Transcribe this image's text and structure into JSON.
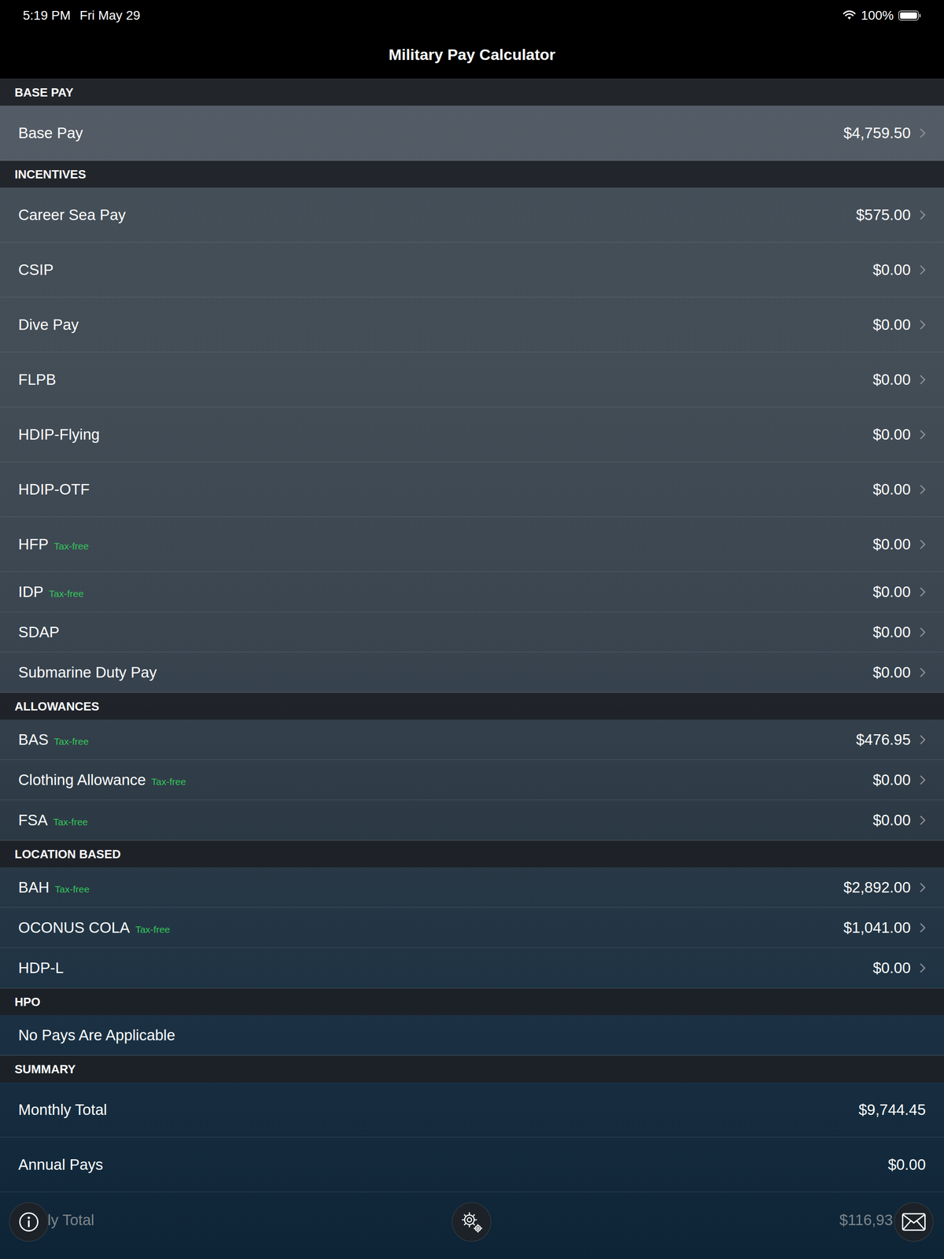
{
  "status_bar": {
    "time": "5:19 PM",
    "date": "Fri May 29",
    "battery": "100%"
  },
  "window": {
    "title": "Military Pay Calculator"
  },
  "sections": [
    {
      "header": "BASE PAY",
      "rows": [
        {
          "label": "Base Pay",
          "badge": "",
          "value": "$4,759.50",
          "kind": "nav"
        }
      ]
    },
    {
      "header": "INCENTIVES",
      "rows": [
        {
          "label": "Career Sea Pay",
          "badge": "",
          "value": "$575.00",
          "kind": "nav"
        },
        {
          "label": "CSIP",
          "badge": "",
          "value": "$0.00",
          "kind": "nav"
        },
        {
          "label": "Dive Pay",
          "badge": "",
          "value": "$0.00",
          "kind": "nav"
        },
        {
          "label": "FLPB",
          "badge": "",
          "value": "$0.00",
          "kind": "nav"
        },
        {
          "label": "HDIP-Flying",
          "badge": "",
          "value": "$0.00",
          "kind": "nav"
        },
        {
          "label": "HDIP-OTF",
          "badge": "",
          "value": "$0.00",
          "kind": "nav"
        },
        {
          "label": "HFP",
          "badge": "Tax-free",
          "value": "$0.00",
          "kind": "nav"
        },
        {
          "label": "IDP",
          "badge": "Tax-free",
          "value": "$0.00",
          "kind": "nav"
        },
        {
          "label": "SDAP",
          "badge": "",
          "value": "$0.00",
          "kind": "nav"
        },
        {
          "label": "Submarine Duty Pay",
          "badge": "",
          "value": "$0.00",
          "kind": "nav"
        }
      ]
    },
    {
      "header": "ALLOWANCES",
      "rows": [
        {
          "label": "BAS",
          "badge": "Tax-free",
          "value": "$476.95",
          "kind": "nav"
        },
        {
          "label": "Clothing Allowance",
          "badge": "Tax-free",
          "value": "$0.00",
          "kind": "nav"
        },
        {
          "label": "FSA",
          "badge": "Tax-free",
          "value": "$0.00",
          "kind": "nav"
        }
      ]
    },
    {
      "header": "LOCATION BASED",
      "rows": [
        {
          "label": "BAH",
          "badge": "Tax-free",
          "value": "$2,892.00",
          "kind": "nav"
        },
        {
          "label": "OCONUS COLA",
          "badge": "Tax-free",
          "value": "$1,041.00",
          "kind": "nav"
        },
        {
          "label": "HDP-L",
          "badge": "",
          "value": "$0.00",
          "kind": "nav"
        }
      ]
    },
    {
      "header": "HPO",
      "rows": [
        {
          "label": "No Pays Are Applicable",
          "badge": "",
          "value": "",
          "kind": "plain"
        }
      ]
    },
    {
      "header": "SUMMARY",
      "rows": [
        {
          "label": "Monthly Total",
          "badge": "",
          "value": "$9,744.45",
          "kind": "summary"
        },
        {
          "label": "Annual Pays",
          "badge": "",
          "value": "$0.00",
          "kind": "summary"
        },
        {
          "label": "ly Total",
          "badge": "",
          "value": "$116,93",
          "kind": "covered"
        }
      ]
    }
  ]
}
